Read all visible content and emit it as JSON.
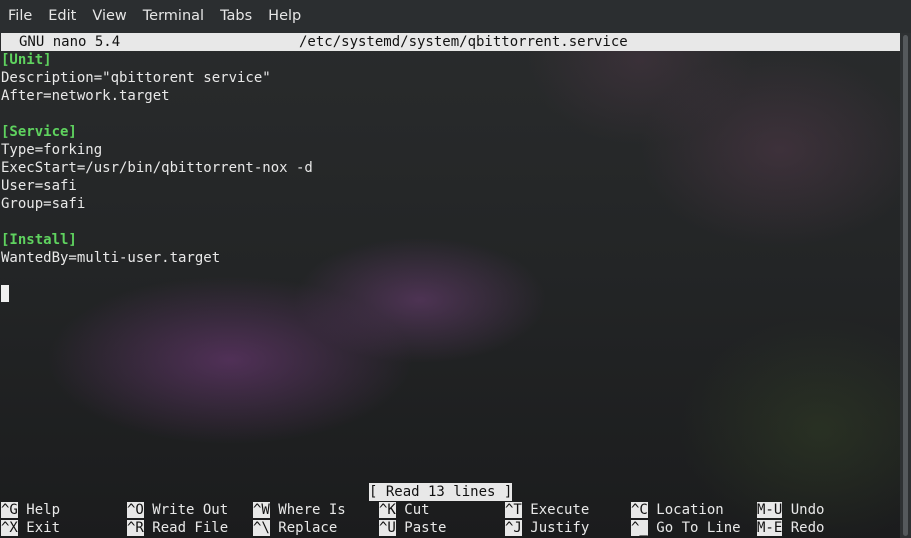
{
  "menubar": {
    "items": [
      "File",
      "Edit",
      "View",
      "Terminal",
      "Tabs",
      "Help"
    ]
  },
  "editor": {
    "version": "GNU nano 5.4",
    "filename": "/etc/systemd/system/qbittorrent.service",
    "lines": [
      {
        "text": "[Unit]",
        "section": true
      },
      {
        "text": "Description=\"qbittorent service\"",
        "section": false
      },
      {
        "text": "After=network.target",
        "section": false
      },
      {
        "text": "",
        "section": false
      },
      {
        "text": "[Service]",
        "section": true
      },
      {
        "text": "Type=forking",
        "section": false
      },
      {
        "text": "ExecStart=/usr/bin/qbittorrent-nox -d",
        "section": false
      },
      {
        "text": "User=safi",
        "section": false
      },
      {
        "text": "Group=safi",
        "section": false
      },
      {
        "text": "",
        "section": false
      },
      {
        "text": "[Install]",
        "section": true
      },
      {
        "text": "WantedBy=multi-user.target",
        "section": false
      }
    ],
    "status": "[ Read 13 lines ]"
  },
  "shortcuts": [
    [
      {
        "key": "^G",
        "label": "Help"
      },
      {
        "key": "^O",
        "label": "Write Out"
      },
      {
        "key": "^W",
        "label": "Where Is"
      },
      {
        "key": "^K",
        "label": "Cut"
      },
      {
        "key": "^T",
        "label": "Execute"
      },
      {
        "key": "^C",
        "label": "Location"
      },
      {
        "key": "M-U",
        "label": "Undo"
      }
    ],
    [
      {
        "key": "^X",
        "label": "Exit"
      },
      {
        "key": "^R",
        "label": "Read File"
      },
      {
        "key": "^\\",
        "label": "Replace"
      },
      {
        "key": "^U",
        "label": "Paste"
      },
      {
        "key": "^J",
        "label": "Justify"
      },
      {
        "key": "^_",
        "label": "Go To Line"
      },
      {
        "key": "M-E",
        "label": "Redo"
      }
    ]
  ]
}
